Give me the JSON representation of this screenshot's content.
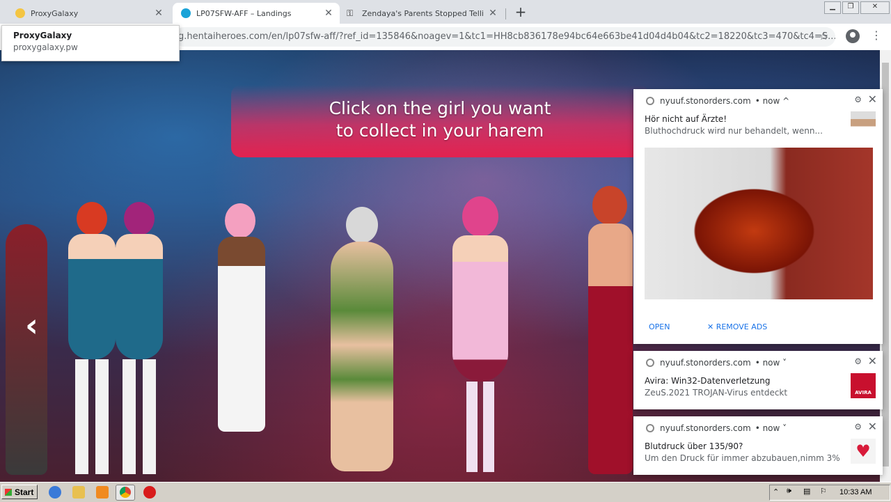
{
  "tabs": [
    {
      "title": "ProxyGalaxy",
      "active": false,
      "icon": "proxygalaxy-favicon"
    },
    {
      "title": "LP07SFW-AFF – Landings",
      "active": true,
      "icon": "landings-favicon"
    },
    {
      "title": "Zendaya's Parents Stopped Telling H",
      "active": false,
      "icon": "key-favicon"
    }
  ],
  "newtab_label": "+",
  "tooltip": {
    "title": "ProxyGalaxy",
    "url": "proxygalaxy.pw"
  },
  "address_bar": {
    "url": "g.hentaiheroes.com/en/lp07sfw-aff/?ref_id=135846&noagev=1&tc1=HH8cb836178e94bc64e663be41d04d4b04&tc2=18220&tc3=470&tc4=S..."
  },
  "page": {
    "banner_line1": "Click on the girl you want",
    "banner_line2": "to collect in your harem",
    "prev_arrow": "‹"
  },
  "notifications": [
    {
      "source": "nyuuf.stonorders.com",
      "time": "• now ^",
      "title": "Hör nicht auf Ärzte!",
      "body": "Bluthochdruck wird nur behandelt, wenn...",
      "open_label": "OPEN",
      "remove_label": "✕ REMOVE ADS"
    },
    {
      "source": "nyuuf.stonorders.com",
      "time": "• now ˅",
      "title": "Avira: Win32-Datenverletzung",
      "body": "ZeuS.2021 TROJAN-Virus entdeckt",
      "thumb_text": "AVIRA"
    },
    {
      "source": "nyuuf.stonorders.com",
      "time": "• now ˅",
      "title": "Blutdruck über 135/90?",
      "body": "Um den Druck für immer abzubauen,nimm 3%"
    }
  ],
  "taskbar": {
    "start_label": "Start",
    "clock": "10:33 AM"
  },
  "colors": {
    "banner": "#e3224f",
    "tabstrip": "#dee1e6",
    "taskbar": "#d4d0c8",
    "link": "#1a73e8"
  }
}
